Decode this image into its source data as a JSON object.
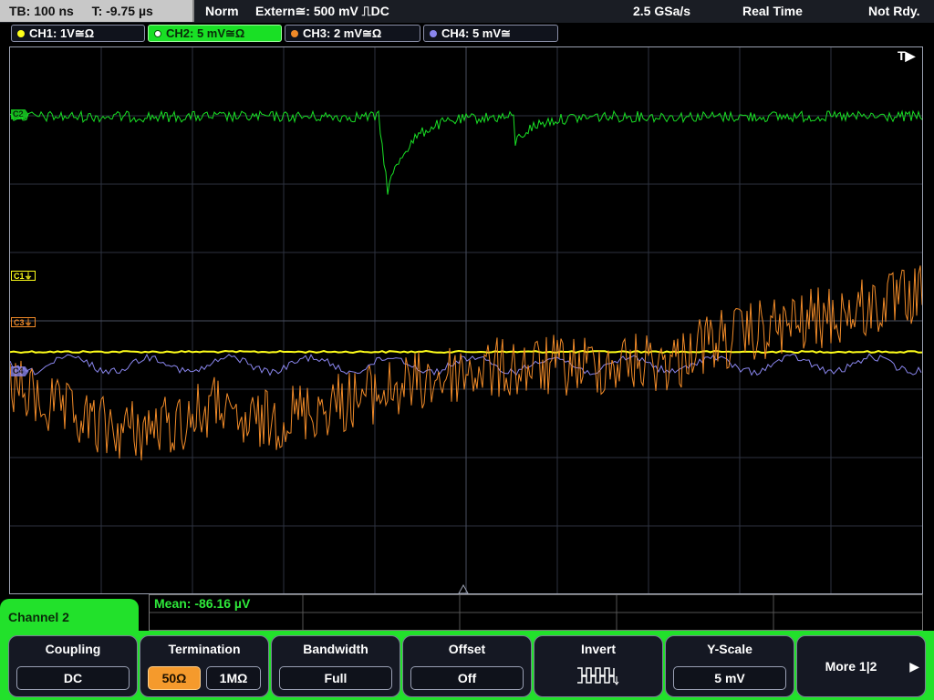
{
  "topbar": {
    "timebase": "TB: 100 ns",
    "trigger_time": "T: -9.75 µs",
    "trigger_mode": "Norm",
    "trigger_source": "Extern≅: 500 mV ⎍DC",
    "sample_rate": "2.5 GSa/s",
    "acq_mode": "Real Time",
    "status": "Not Rdy."
  },
  "channels": [
    {
      "label": "CH1: 1V≅Ω",
      "color": "#ffff1a"
    },
    {
      "label": "CH2: 5 mV≅Ω",
      "color": "#19e025"
    },
    {
      "label": "CH3: 2 mV≅Ω",
      "color": "#f08a28"
    },
    {
      "label": "CH4: 5 mV≅",
      "color": "#8a86ee"
    }
  ],
  "trigger_indicator": "T▶",
  "markers": {
    "c1": "C1⏚",
    "c2": "C2",
    "c3": "C3⏚",
    "c4": "C4"
  },
  "measurement": {
    "mean": "Mean: -86.16 µV"
  },
  "menu_title": "Channel 2",
  "softkeys": {
    "coupling": {
      "title": "Coupling",
      "value": "DC"
    },
    "termination": {
      "title": "Termination",
      "option1": "50Ω",
      "option2": "1MΩ"
    },
    "bandwidth": {
      "title": "Bandwidth",
      "value": "Full"
    },
    "offset": {
      "title": "Offset",
      "value": "Off"
    },
    "invert": {
      "title": "Invert"
    },
    "yscale": {
      "title": "Y-Scale",
      "value": "5 mV"
    },
    "more": {
      "label": "More 1|2",
      "arrow": "▶"
    }
  }
}
